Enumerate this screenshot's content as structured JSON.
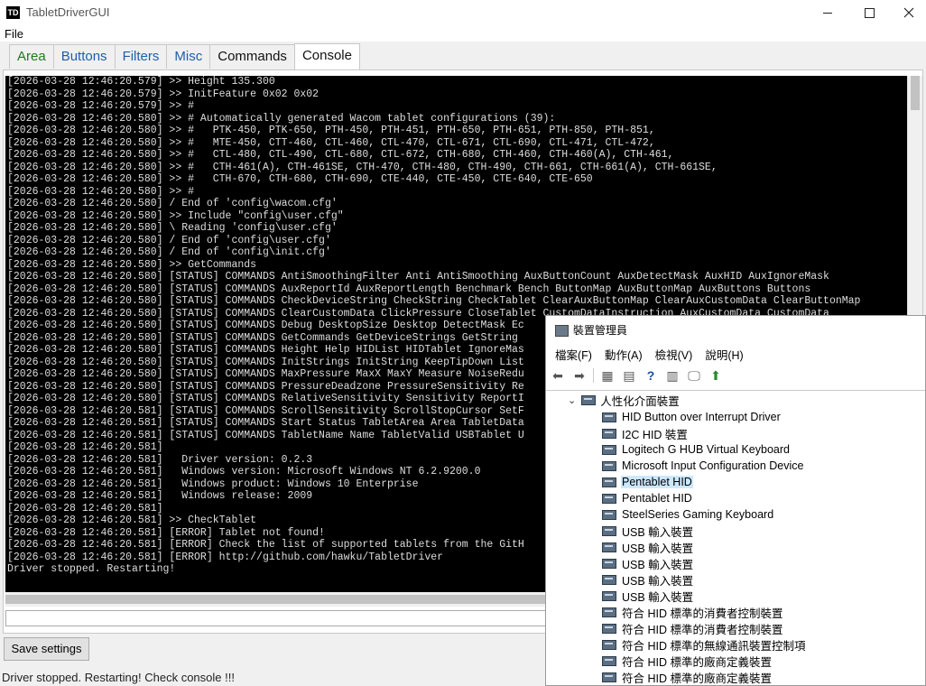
{
  "window": {
    "app_icon": "TD",
    "title": "TabletDriverGUI"
  },
  "menu": {
    "file": "File"
  },
  "tabs": [
    {
      "label": "Area"
    },
    {
      "label": "Buttons"
    },
    {
      "label": "Filters"
    },
    {
      "label": "Misc"
    },
    {
      "label": "Commands"
    },
    {
      "label": "Console"
    }
  ],
  "console_lines": [
    "[2026-03-28 12:46:20.579] >> Height 135.300",
    "[2026-03-28 12:46:20.579] >> InitFeature 0x02 0x02",
    "[2026-03-28 12:46:20.579] >> #",
    "[2026-03-28 12:46:20.580] >> # Automatically generated Wacom tablet configurations (39):",
    "[2026-03-28 12:46:20.580] >> #   PTK-450, PTK-650, PTH-450, PTH-451, PTH-650, PTH-651, PTH-850, PTH-851,",
    "[2026-03-28 12:46:20.580] >> #   MTE-450, CTT-460, CTL-460, CTL-470, CTL-671, CTL-690, CTL-471, CTL-472,",
    "[2026-03-28 12:46:20.580] >> #   CTL-480, CTL-490, CTL-680, CTL-672, CTH-680, CTH-460, CTH-460(A), CTH-461,",
    "[2026-03-28 12:46:20.580] >> #   CTH-461(A), CTH-461SE, CTH-470, CTH-480, CTH-490, CTH-661, CTH-661(A), CTH-661SE,",
    "[2026-03-28 12:46:20.580] >> #   CTH-670, CTH-680, CTH-690, CTE-440, CTE-450, CTE-640, CTE-650",
    "[2026-03-28 12:46:20.580] >> #",
    "[2026-03-28 12:46:20.580] / End of 'config\\wacom.cfg'",
    "[2026-03-28 12:46:20.580] >> Include \"config\\user.cfg\"",
    "[2026-03-28 12:46:20.580] \\ Reading 'config\\user.cfg'",
    "[2026-03-28 12:46:20.580] / End of 'config\\user.cfg'",
    "[2026-03-28 12:46:20.580] / End of 'config\\init.cfg'",
    "[2026-03-28 12:46:20.580] >> GetCommands",
    "[2026-03-28 12:46:20.580] [STATUS] COMMANDS AntiSmoothingFilter Anti AntiSmoothing AuxButtonCount AuxDetectMask AuxHID AuxIgnoreMask",
    "[2026-03-28 12:46:20.580] [STATUS] COMMANDS AuxReportId AuxReportLength Benchmark Bench ButtonMap AuxButtonMap AuxButtons Buttons",
    "[2026-03-28 12:46:20.580] [STATUS] COMMANDS CheckDeviceString CheckString CheckTablet ClearAuxButtonMap ClearAuxCustomData ClearButtonMap",
    "[2026-03-28 12:46:20.580] [STATUS] COMMANDS ClearCustomData ClickPressure CloseTablet CustomDataInstruction AuxCustomData CustomData",
    "[2026-03-28 12:46:20.580] [STATUS] COMMANDS Debug DesktopSize Desktop DetectMask Ec",
    "[2026-03-28 12:46:20.580] [STATUS] COMMANDS GetCommands GetDeviceStrings GetString",
    "[2026-03-28 12:46:20.580] [STATUS] COMMANDS Height Help HIDList HIDTablet IgnoreMas",
    "[2026-03-28 12:46:20.580] [STATUS] COMMANDS InitStrings InitString KeepTipDown List",
    "[2026-03-28 12:46:20.580] [STATUS] COMMANDS MaxPressure MaxX MaxY Measure NoiseRedu",
    "[2026-03-28 12:46:20.580] [STATUS] COMMANDS PressureDeadzone PressureSensitivity Re",
    "[2026-03-28 12:46:20.580] [STATUS] COMMANDS RelativeSensitivity Sensitivity ReportI",
    "[2026-03-28 12:46:20.581] [STATUS] COMMANDS ScrollSensitivity ScrollStopCursor SetF",
    "[2026-03-28 12:46:20.581] [STATUS] COMMANDS Start Status TabletArea Area TabletData",
    "[2026-03-28 12:46:20.581] [STATUS] COMMANDS TabletName Name TabletValid USBTablet U",
    "[2026-03-28 12:46:20.581]",
    "[2026-03-28 12:46:20.581]   Driver version: 0.2.3",
    "[2026-03-28 12:46:20.581]   Windows version: Microsoft Windows NT 6.2.9200.0",
    "[2026-03-28 12:46:20.581]   Windows product: Windows 10 Enterprise",
    "[2026-03-28 12:46:20.581]   Windows release: 2009",
    "[2026-03-28 12:46:20.581]",
    "[2026-03-28 12:46:20.581] >> CheckTablet",
    "[2026-03-28 12:46:20.581] [ERROR] Tablet not found!",
    "[2026-03-28 12:46:20.581] [ERROR] Check the list of supported tablets from the GitH",
    "[2026-03-28 12:46:20.581] [ERROR] http://github.com/hawku/TabletDriver",
    "Driver stopped. Restarting!"
  ],
  "buttons": {
    "save_settings": "Save settings"
  },
  "status_bar": "Driver stopped. Restarting! Check console !!!",
  "device_manager": {
    "title": "裝置管理員",
    "menu": [
      "檔案(F)",
      "動作(A)",
      "檢視(V)",
      "說明(H)"
    ],
    "category": "人性化介面裝置",
    "items": [
      {
        "label": "HID Button over Interrupt Driver",
        "selected": false
      },
      {
        "label": "I2C HID 裝置",
        "selected": false
      },
      {
        "label": "Logitech G HUB Virtual Keyboard",
        "selected": false
      },
      {
        "label": "Microsoft Input Configuration Device",
        "selected": false
      },
      {
        "label": "Pentablet HID",
        "selected": true
      },
      {
        "label": "Pentablet HID",
        "selected": false
      },
      {
        "label": "SteelSeries Gaming Keyboard",
        "selected": false
      },
      {
        "label": "USB 輸入裝置",
        "selected": false
      },
      {
        "label": "USB 輸入裝置",
        "selected": false
      },
      {
        "label": "USB 輸入裝置",
        "selected": false
      },
      {
        "label": "USB 輸入裝置",
        "selected": false
      },
      {
        "label": "USB 輸入裝置",
        "selected": false
      },
      {
        "label": "符合 HID 標準的消費者控制裝置",
        "selected": false
      },
      {
        "label": "符合 HID 標準的消費者控制裝置",
        "selected": false
      },
      {
        "label": "符合 HID 標準的無線通訊裝置控制項",
        "selected": false
      },
      {
        "label": "符合 HID 標準的廠商定義裝置",
        "selected": false
      },
      {
        "label": "符合 HID 標準的廠商定義裝置",
        "selected": false
      }
    ]
  }
}
